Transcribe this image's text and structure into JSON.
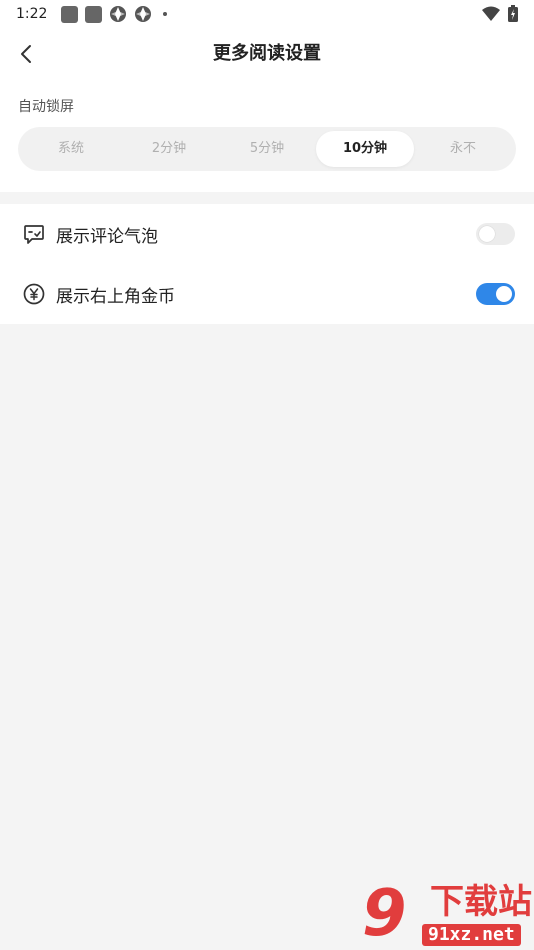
{
  "status_bar": {
    "time": "1:22"
  },
  "header": {
    "title": "更多阅读设置",
    "back_icon": "chevron-left-icon"
  },
  "auto_lock": {
    "label": "自动锁屏",
    "options": [
      "系统",
      "2分钟",
      "5分钟",
      "10分钟",
      "永不"
    ],
    "selected": "10分钟"
  },
  "settings": {
    "comment_bubble": {
      "label": "展示评论气泡",
      "icon": "comment-bubble-icon",
      "enabled": false
    },
    "coin": {
      "label": "展示右上角金币",
      "icon": "yen-coin-icon",
      "enabled": true
    }
  },
  "watermark": {
    "mark": "9",
    "title": "下载站",
    "url": "91xz.net"
  },
  "colors": {
    "accent": "#2f87e8",
    "toggle_off": "#ececec",
    "background": "#f4f4f4",
    "watermark_red": "#e13d3d"
  }
}
